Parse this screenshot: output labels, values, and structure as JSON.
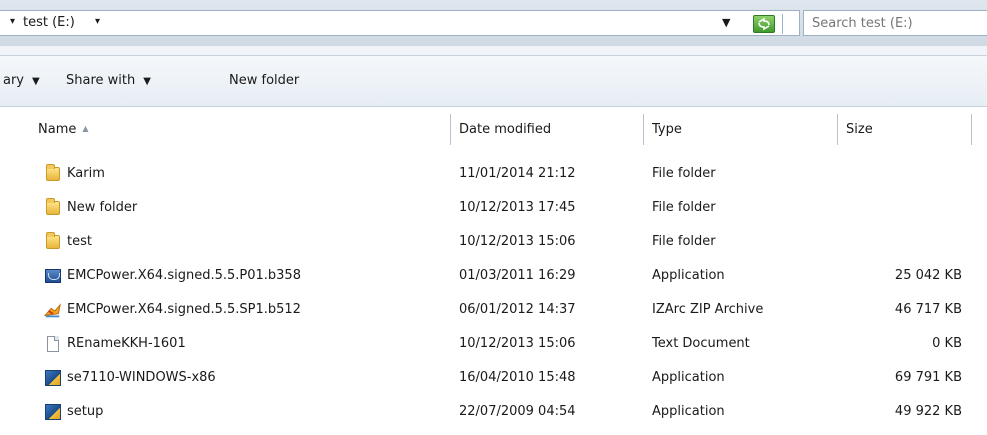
{
  "address_bar": {
    "path_label": "test (E:)",
    "search_placeholder": "Search test (E:)"
  },
  "toolbar": {
    "library_label": "ary",
    "share_label": "Share with",
    "new_folder_label": "New folder"
  },
  "columns": {
    "name": "Name",
    "date": "Date modified",
    "type": "Type",
    "size": "Size"
  },
  "files": [
    {
      "name": "Karim",
      "date": "11/01/2014 21:12",
      "type": "File folder",
      "size": "",
      "icon": "folder-icon"
    },
    {
      "name": "New folder",
      "date": "10/12/2013 17:45",
      "type": "File folder",
      "size": "",
      "icon": "folder-icon"
    },
    {
      "name": "test",
      "date": "10/12/2013 15:06",
      "type": "File folder",
      "size": "",
      "icon": "folder-icon"
    },
    {
      "name": "EMCPower.X64.signed.5.5.P01.b358",
      "date": "01/03/2011 16:29",
      "type": "Application",
      "size": "25 042 KB",
      "icon": "application-icon"
    },
    {
      "name": "EMCPower.X64.signed.5.5.SP1.b512",
      "date": "06/01/2012 14:37",
      "type": "IZArc ZIP Archive",
      "size": "46 717 KB",
      "icon": "zip-archive-icon"
    },
    {
      "name": "REnameKKH-1601",
      "date": "10/12/2013 15:06",
      "type": "Text Document",
      "size": "0 KB",
      "icon": "text-document-icon"
    },
    {
      "name": "se7110-WINDOWS-x86",
      "date": "16/04/2010 15:48",
      "type": "Application",
      "size": "69 791 KB",
      "icon": "installer-icon"
    },
    {
      "name": "setup",
      "date": "22/07/2009 04:54",
      "type": "Application",
      "size": "49 922 KB",
      "icon": "installer-icon"
    }
  ]
}
